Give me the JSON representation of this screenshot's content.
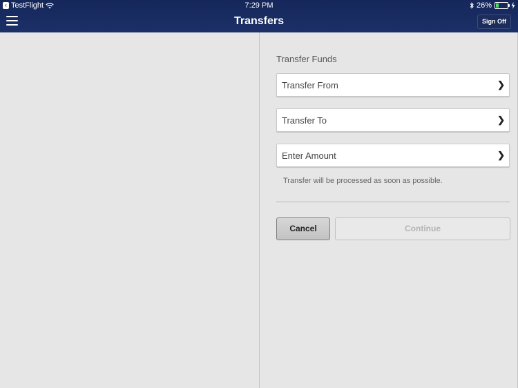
{
  "status_bar": {
    "back_app": "TestFlight",
    "time": "7:29 PM",
    "battery_percent": "26%",
    "battery_level": 0.26
  },
  "nav_bar": {
    "title": "Transfers",
    "sign_off": "Sign Off"
  },
  "form": {
    "section_title": "Transfer Funds",
    "rows": [
      {
        "label": "Transfer From"
      },
      {
        "label": "Transfer To"
      },
      {
        "label": "Enter Amount"
      }
    ],
    "note": "Transfer will be processed as soon as possible.",
    "cancel_label": "Cancel",
    "continue_label": "Continue"
  },
  "colors": {
    "nav_background": "#1c3068",
    "page_background": "#e6e6e6",
    "battery_fill": "#4cd964"
  }
}
